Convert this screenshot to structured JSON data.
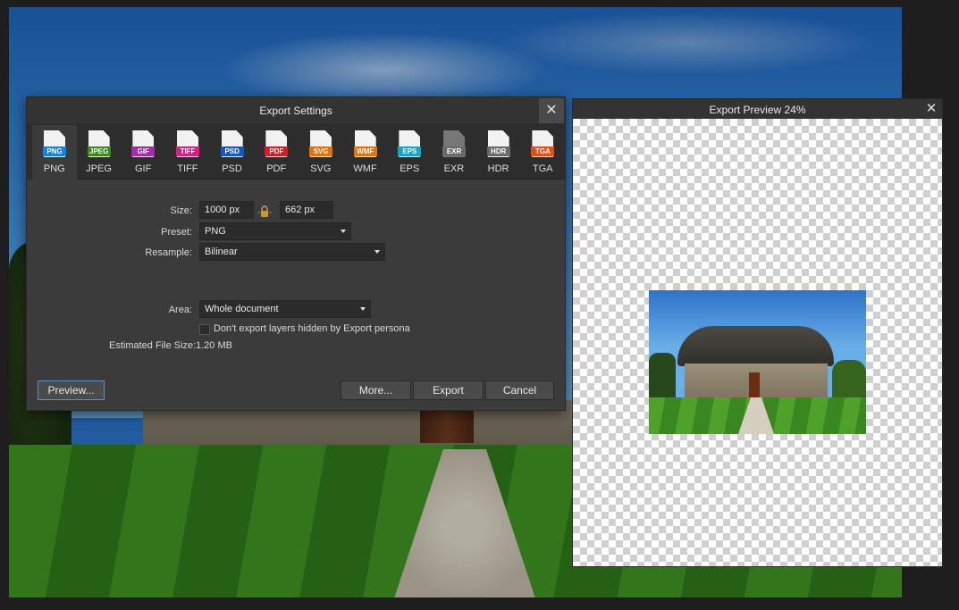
{
  "dialog": {
    "title": "Export Settings",
    "close_glyph": "✕",
    "formats": [
      {
        "label": "PNG",
        "badge": "PNG",
        "color": "#1e7fd6",
        "dark": false,
        "selected": true
      },
      {
        "label": "JPEG",
        "badge": "JPEG",
        "color": "#3b8a1e",
        "dark": false,
        "selected": false
      },
      {
        "label": "GIF",
        "badge": "GIF",
        "color": "#a12ea8",
        "dark": false,
        "selected": false
      },
      {
        "label": "TIFF",
        "badge": "TIFF",
        "color": "#d61f83",
        "dark": false,
        "selected": false
      },
      {
        "label": "PSD",
        "badge": "PSD",
        "color": "#1955c8",
        "dark": false,
        "selected": false
      },
      {
        "label": "PDF",
        "badge": "PDF",
        "color": "#d01f25",
        "dark": false,
        "selected": false
      },
      {
        "label": "SVG",
        "badge": "SVG",
        "color": "#e0720f",
        "dark": false,
        "selected": false
      },
      {
        "label": "WMF",
        "badge": "WMF",
        "color": "#e0720f",
        "dark": false,
        "selected": false
      },
      {
        "label": "EPS",
        "badge": "EPS",
        "color": "#18a2c4",
        "dark": false,
        "selected": false
      },
      {
        "label": "EXR",
        "badge": "EXR",
        "color": "#6a6a6a",
        "dark": true,
        "selected": false
      },
      {
        "label": "HDR",
        "badge": "HDR",
        "color": "#6a6a6a",
        "dark": false,
        "selected": false
      },
      {
        "label": "TGA",
        "badge": "TGA",
        "color": "#e0501a",
        "dark": false,
        "selected": false
      }
    ],
    "size": {
      "label": "Size:",
      "width": "1000 px",
      "height": "662 px"
    },
    "preset": {
      "label": "Preset:",
      "value": "PNG"
    },
    "resample": {
      "label": "Resample:",
      "value": "Bilinear"
    },
    "area": {
      "label": "Area:",
      "value": "Whole document"
    },
    "hidden_layers": {
      "label": "Don't export layers hidden by Export persona",
      "checked": false
    },
    "file_size": {
      "label": "Estimated File Size:",
      "value": "1.20 MB"
    },
    "buttons": {
      "preview": "Preview...",
      "more": "More...",
      "export": "Export",
      "cancel": "Cancel"
    }
  },
  "preview_panel": {
    "title": "Export Preview 24%",
    "close_glyph": "✕"
  },
  "icons": {
    "lock": "lock-icon",
    "close": "close-icon",
    "dropdown": "chevron-down-icon"
  }
}
